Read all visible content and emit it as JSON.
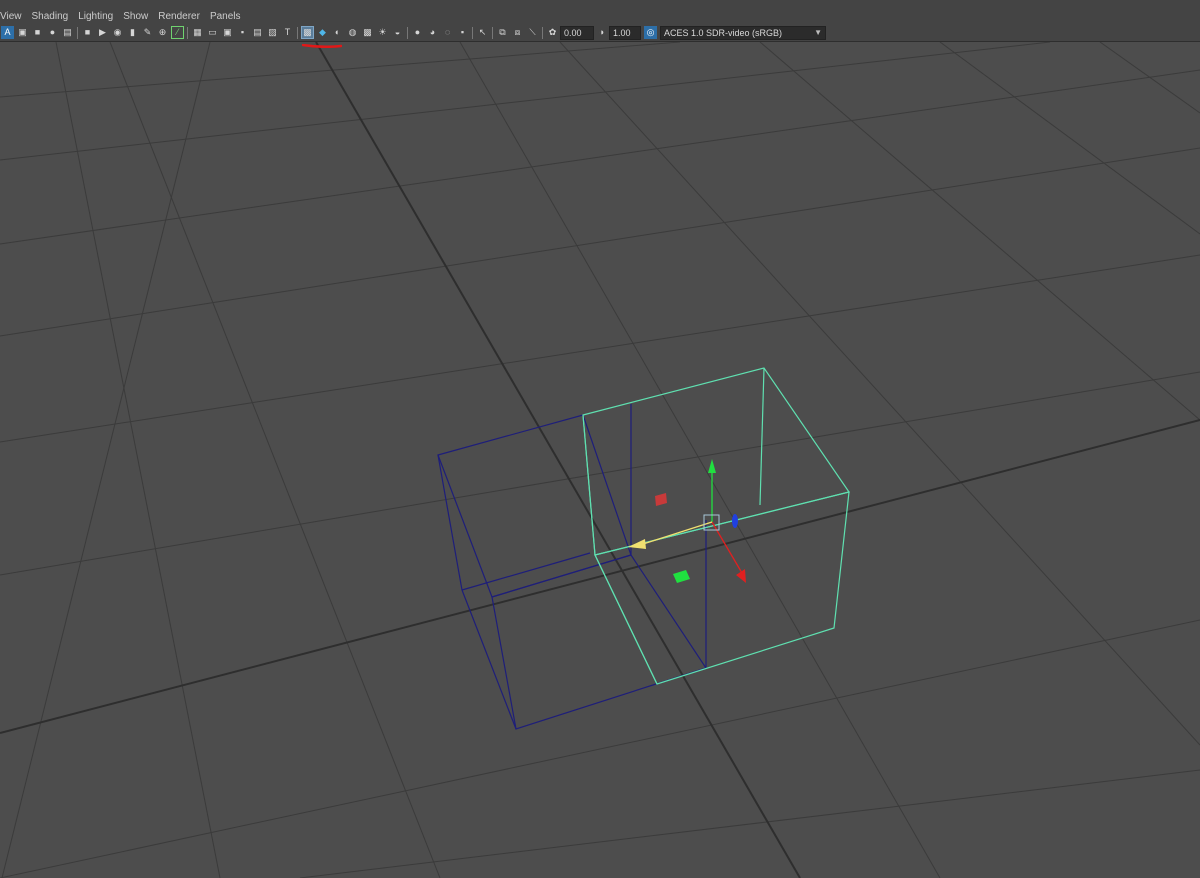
{
  "menubar": {
    "items": [
      "View",
      "Shading",
      "Lighting",
      "Show",
      "Renderer",
      "Panels"
    ]
  },
  "toolbar": {
    "icon_groups": [
      [
        "A",
        "▣",
        "■",
        "●",
        "▤"
      ],
      [
        "■",
        "▶",
        "◉",
        "▮",
        "✎",
        "⊕",
        "⁄"
      ],
      [
        "▦",
        "▭",
        "▣",
        "▪",
        "▤",
        "▨",
        "T"
      ],
      [
        "▩",
        "◆",
        "◐",
        "◍",
        "▩",
        "☀",
        "◒"
      ],
      [
        "●",
        "◕",
        "◌",
        "▪"
      ],
      [
        "↖"
      ],
      [
        "⧉",
        "⧈",
        "⟍"
      ],
      [
        "✿"
      ]
    ],
    "gamma_value": "0.00",
    "exposure_value": "1.00",
    "colorspace": "ACES 1.0 SDR-video (sRGB)",
    "colorspace_arrow": "▼"
  },
  "viewport": {
    "background": "#4d4d4d",
    "grid_color": "#3a3a3a",
    "axis_color": "#2e2e2e",
    "box_unselected_color": "#1e1e7a",
    "box_selected_color": "#5fe0b0",
    "gizmo": {
      "x_color": "#e02020",
      "y_color": "#20e040",
      "z_color": "#2040e0",
      "center_color": "#a8c8d8",
      "arrow_color": "#f0e070"
    }
  },
  "annotation": {
    "color": "#e01818"
  }
}
